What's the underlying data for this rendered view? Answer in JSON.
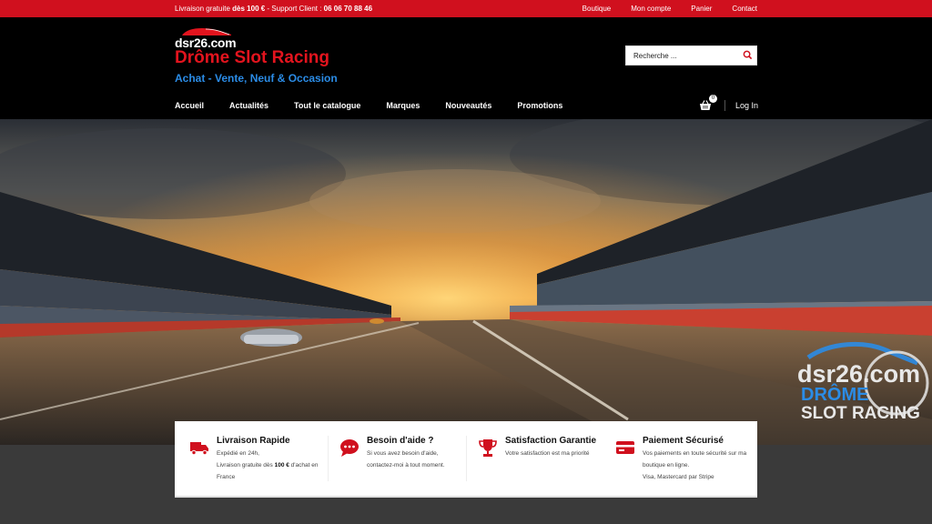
{
  "topbar": {
    "shipping_prefix": "Livraison gratuite ",
    "shipping_bold": "dès 100 €",
    "support_label": " - Support Client : ",
    "phone": "06 06 70 88 46",
    "links": [
      "Boutique",
      "Mon compte",
      "Panier",
      "Contact"
    ]
  },
  "header": {
    "logo_domain": "dsr26.com",
    "brand": "Drôme Slot Racing",
    "tagline": "Achat - Vente, Neuf & Occasion",
    "search_placeholder": "Recherche ..."
  },
  "nav": {
    "items": [
      "Accueil",
      "Actualités",
      "Tout le catalogue",
      "Marques",
      "Nouveautés",
      "Promotions"
    ],
    "cart_count": "0",
    "login": "Log In"
  },
  "hero": {
    "watermark_domain": "dsr26.com",
    "watermark_line1": "DRÔME",
    "watermark_line2": "SLOT RACING"
  },
  "features": [
    {
      "icon": "truck-icon",
      "title": "Livraison Rapide",
      "line1": "Expédié en 24h,",
      "line2_prefix": "Livraison gratuite dès ",
      "line2_bold": "100 €",
      "line2_suffix": " d'achat en France"
    },
    {
      "icon": "chat-icon",
      "title": "Besoin d'aide ?",
      "line1": "Si vous avez besoin d'aide,",
      "line2": "contactez-moi à tout moment."
    },
    {
      "icon": "trophy-icon",
      "title": "Satisfaction Garantie",
      "line1": "Votre satisfaction est ma priorité"
    },
    {
      "icon": "credit-card-icon",
      "title": "Paiement Sécurisé",
      "line1": "Vos paiements en toute sécurité sur ma boutique en ligne.",
      "line2": "Visa, Mastercard par Stripe"
    }
  ],
  "colors": {
    "accent_red": "#d0101e",
    "brand_red": "#e3141e",
    "tagline_blue": "#2b8ce6",
    "header_bg": "#000000"
  }
}
